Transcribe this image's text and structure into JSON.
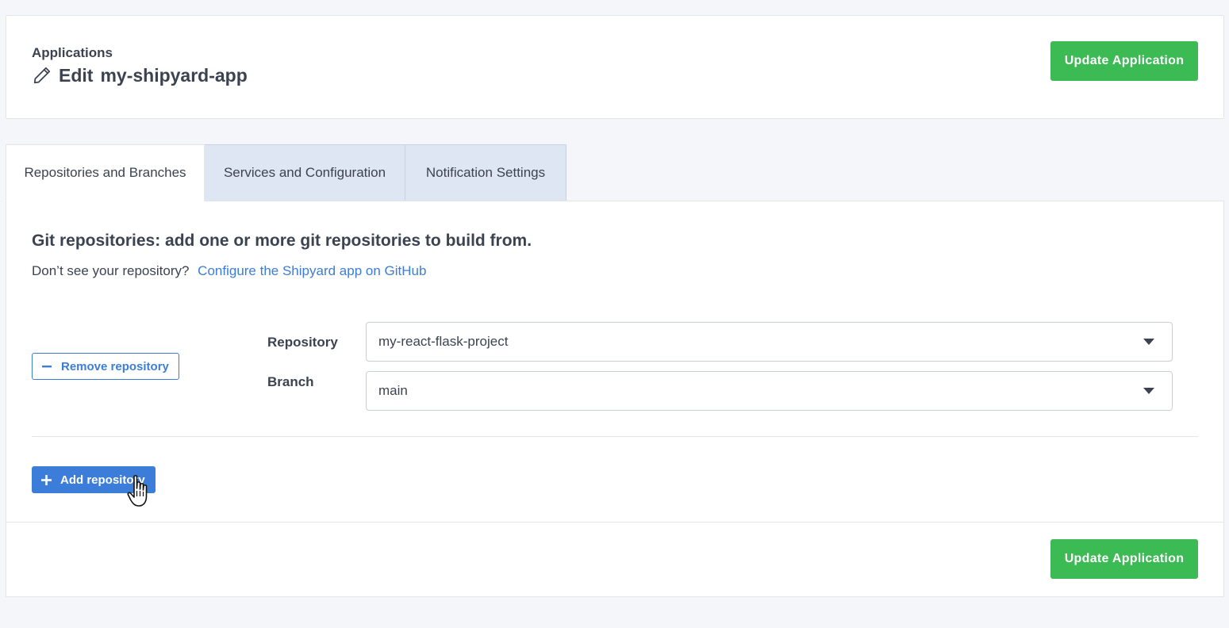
{
  "header": {
    "breadcrumb": "Applications",
    "title_prefix": "Edit",
    "app_name": "my-shipyard-app",
    "update_label": "Update Application",
    "edit_icon": "pencil-icon"
  },
  "tabs": [
    {
      "label": "Repositories and Branches",
      "active": true
    },
    {
      "label": "Services and Configuration",
      "active": false
    },
    {
      "label": "Notification Settings",
      "active": false
    }
  ],
  "repos_section": {
    "title": "Git repositories: add one or more git repositories to build from.",
    "help_text": "Don’t see your repository?",
    "help_link": "Configure the Shipyard app on GitHub",
    "remove_label": "Remove repository",
    "repository_label": "Repository",
    "repository_value": "my-react-flask-project",
    "branch_label": "Branch",
    "branch_value": "main",
    "add_label": "Add repository"
  },
  "footer": {
    "update_label": "Update Application"
  },
  "colors": {
    "accent_green": "#3cba54",
    "accent_blue": "#3b7dd8",
    "tab_inactive_bg": "#dfe6f3",
    "page_bg": "#f5f6fa"
  }
}
